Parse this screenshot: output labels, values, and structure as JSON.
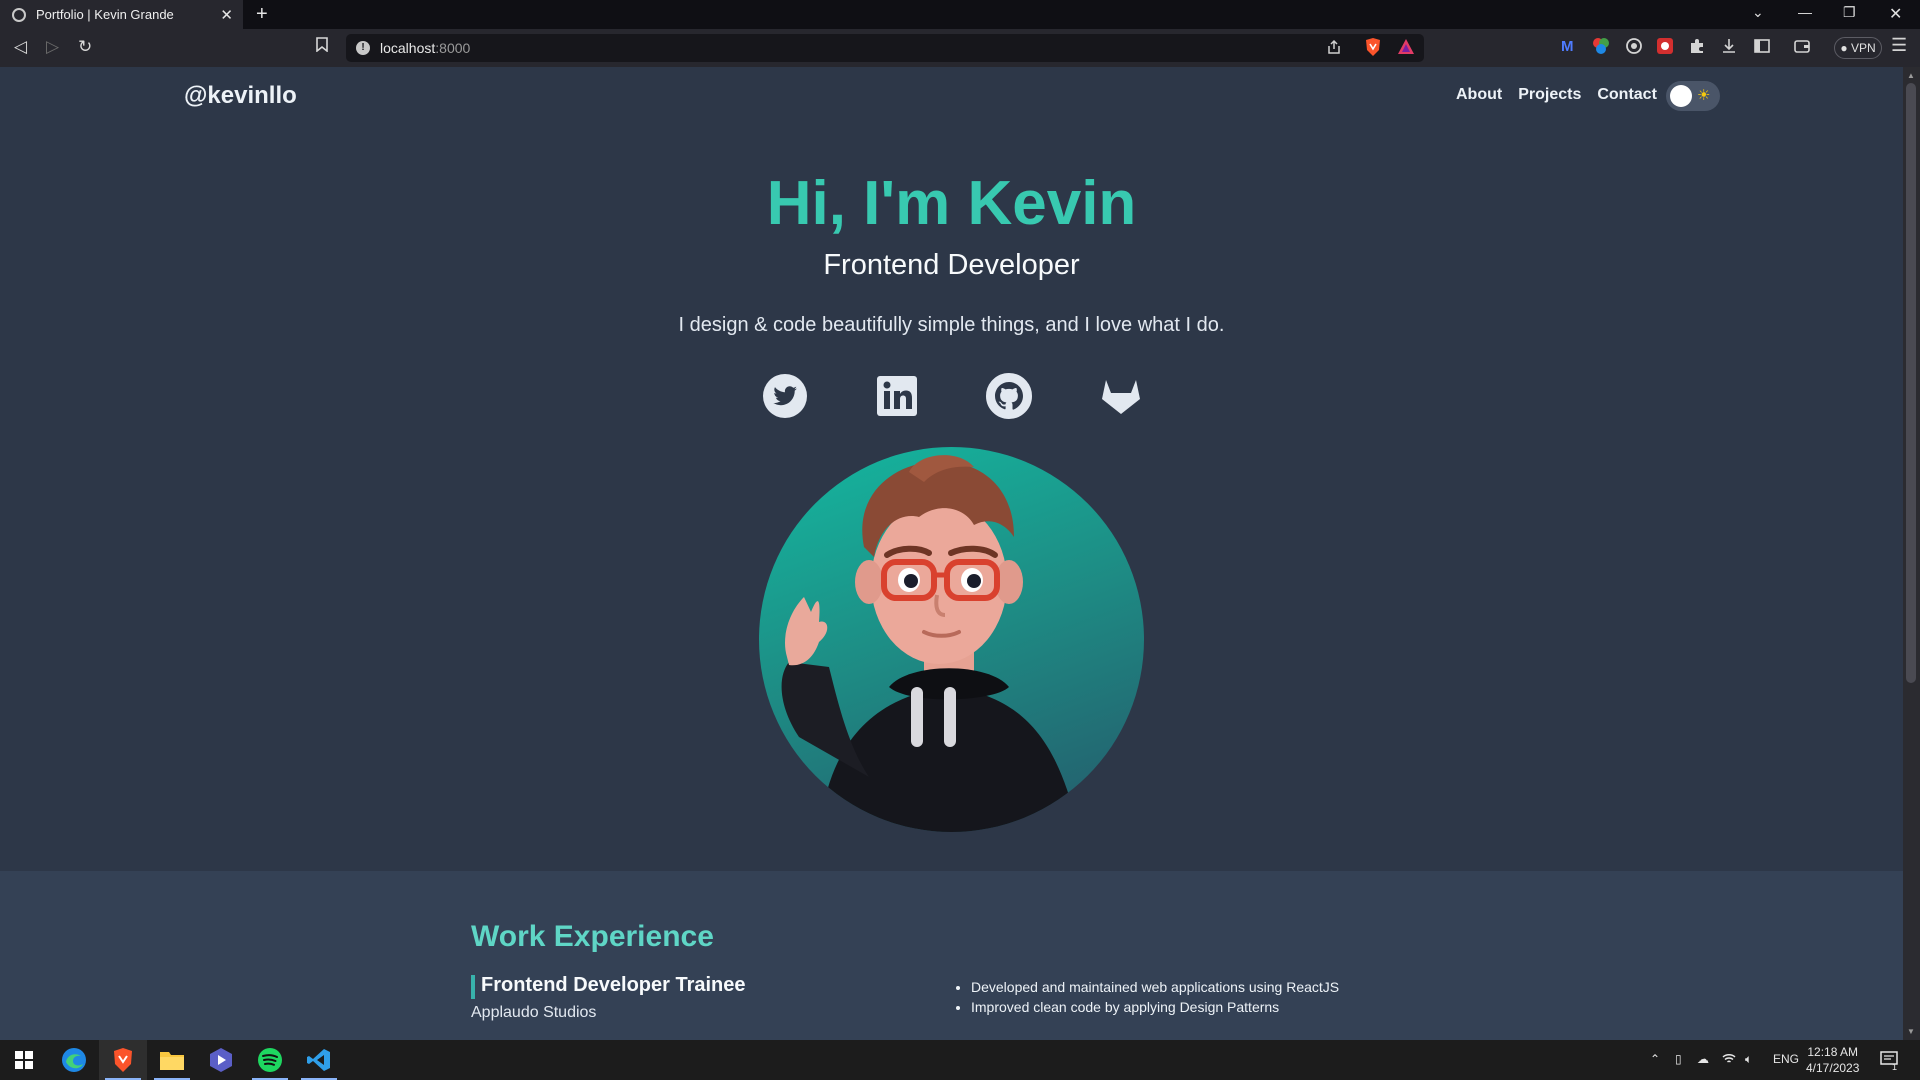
{
  "browser": {
    "tab_title": "Portfolio | Kevin Grande",
    "tab_close": "✕",
    "new_tab": "+",
    "url_host": "localhost",
    "url_port": ":8000",
    "vpn_label": "● VPN"
  },
  "header": {
    "brand": "@kevinllo",
    "nav": [
      "About",
      "Projects",
      "Contact"
    ],
    "theme_toggle_icon": "sun-icon"
  },
  "hero": {
    "title": "Hi, I'm Kevin",
    "subtitle": "Frontend Developer",
    "tagline": "I design & code beautifully simple things, and I love what I do.",
    "socials": [
      "twitter-icon",
      "linkedin-icon",
      "github-icon",
      "gitlab-icon"
    ],
    "avatar": "3D cartoon avatar waving"
  },
  "work": {
    "title": "Work Experience",
    "jobs": [
      {
        "title": "Frontend Developer Trainee",
        "company": "Applaudo Studios",
        "bullets": [
          "Developed and maintained web applications using ReactJS",
          "Improved clean code by applying Design Patterns"
        ]
      }
    ]
  },
  "taskbar": {
    "language": "ENG",
    "time": "12:18 AM",
    "date": "4/17/2023",
    "notifications": "1"
  },
  "colors": {
    "page_bg": "#2d3748",
    "accent": "#38c9b0",
    "section_bg": "#344155"
  }
}
